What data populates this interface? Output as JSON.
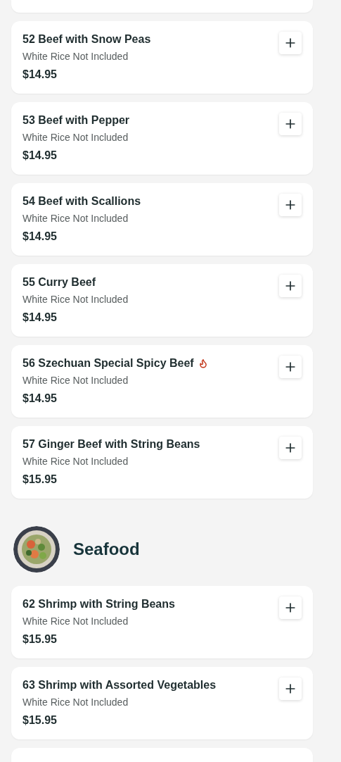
{
  "sections": [
    {
      "items": [
        {
          "name": "52 Beef with Snow Peas",
          "note": "White Rice Not Included",
          "price": "$14.95",
          "spicy": false
        },
        {
          "name": "53 Beef with Pepper",
          "note": "White Rice Not Included",
          "price": "$14.95",
          "spicy": false
        },
        {
          "name": "54 Beef with Scallions",
          "note": "White Rice Not Included",
          "price": "$14.95",
          "spicy": false
        },
        {
          "name": "55 Curry Beef",
          "note": "White Rice Not Included",
          "price": "$14.95",
          "spicy": false
        },
        {
          "name": "56 Szechuan Special Spicy Beef",
          "note": "White Rice Not Included",
          "price": "$14.95",
          "spicy": true
        },
        {
          "name": "57 Ginger Beef with String Beans",
          "note": "White Rice Not Included",
          "price": "$15.95",
          "spicy": false
        }
      ]
    },
    {
      "title": "Seafood",
      "items": [
        {
          "name": "62 Shrimp with String Beans",
          "note": "White Rice Not Included",
          "price": "$15.95",
          "spicy": false
        },
        {
          "name": "63 Shrimp with Assorted Vegetables",
          "note": "White Rice Not Included",
          "price": "$15.95",
          "spicy": false
        }
      ]
    }
  ]
}
